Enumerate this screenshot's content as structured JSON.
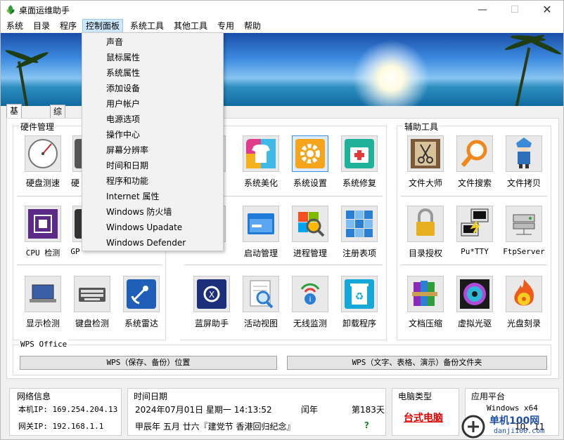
{
  "window": {
    "title": "桌面运维助手",
    "minimize_icon": "minimize-icon",
    "maximize_icon": "maximize-icon",
    "close_icon": "close-icon"
  },
  "menu": {
    "items": [
      "系统",
      "目录",
      "程序",
      "控制面板",
      "系统工具",
      "其他工具",
      "专用",
      "帮助"
    ],
    "active": "控制面板"
  },
  "dropdown": {
    "items": [
      "声音",
      "鼠标属性",
      "系统属性",
      "添加设备",
      "用户帐户",
      "电源选项",
      "操作中心",
      "屏幕分辨率",
      "时间和日期",
      "程序和功能",
      "Internet 属性",
      "Windows 防火墙",
      "Windows Upadate",
      "Windows Defender"
    ]
  },
  "tabs": [
    "基本信息",
    "综合功能"
  ],
  "hardware": {
    "title": "硬件管理",
    "tools": [
      "硬盘测速",
      "硬",
      "CPU 检测",
      "GP",
      "显示检测",
      "键盘检测",
      "系统雷达"
    ]
  },
  "system": {
    "tools": [
      "系统美化",
      "系统设置",
      "系统修复",
      "启动管理",
      "进程管理",
      "注册表项",
      "蓝屏助手",
      "活动视图",
      "无线监测",
      "卸载程序"
    ],
    "selected": "系统设置"
  },
  "aux": {
    "title": "辅助工具",
    "tools": [
      "文件大师",
      "文件搜索",
      "文件拷贝",
      "目录授权",
      "Pu*TTY",
      "FtpServer",
      "文档压缩",
      "虚拟光驱",
      "光盘刻录"
    ]
  },
  "wps": {
    "title": "WPS Office",
    "button1": "WPS（保存、备份）位置",
    "button2": "WPS（文字、表格、演示）备份文件夹"
  },
  "network": {
    "title": "网络信息",
    "local_ip": "本机IP: 169.254.204.13",
    "gateway_ip": "网关IP: 192.168.1.1"
  },
  "datetime": {
    "title": "时间日期",
    "date_line": "2024年07月01日 星期一 14:13:52",
    "leap": "闰年",
    "day_of_year": "第183天",
    "lunar": "甲辰年  五月  廿六『建党节 香港回归纪念』",
    "question": "?"
  },
  "pc": {
    "title": "电脑类型",
    "type": "台式电脑"
  },
  "platform": {
    "title": "应用平台",
    "os": "Windows x64",
    "versions": "10、11"
  },
  "watermark": {
    "text": "单机100网",
    "url": "danji100.com"
  },
  "colors": {
    "accent": "#cce8ff",
    "pc_type": "#e00000",
    "question": "#1a8c2e"
  }
}
